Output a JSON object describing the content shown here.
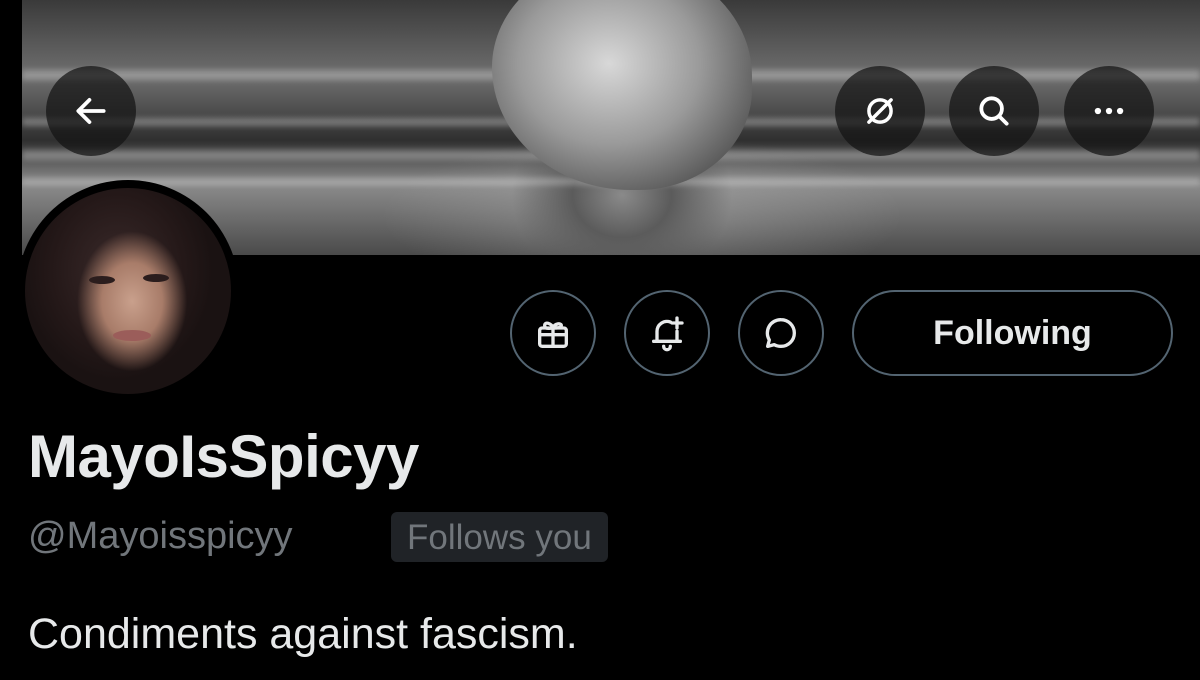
{
  "profile": {
    "display_name": "MayoIsSpicyy",
    "handle": "@Mayoisspicyy",
    "follows_you_badge": "Follows you",
    "bio": "Condiments against fascism."
  },
  "actions": {
    "following_label": "Following"
  },
  "icons": {
    "back": "arrow-left-icon",
    "grok": "slashed-circle-icon",
    "search": "search-icon",
    "more": "more-horizontal-icon",
    "gift": "gift-icon",
    "notifications": "bell-plus-icon",
    "message": "chat-bubble-icon"
  },
  "colors": {
    "background": "#000000",
    "text_primary": "#e7e9ea",
    "text_secondary": "#71767b",
    "border": "#536471",
    "badge_bg": "#202327"
  }
}
